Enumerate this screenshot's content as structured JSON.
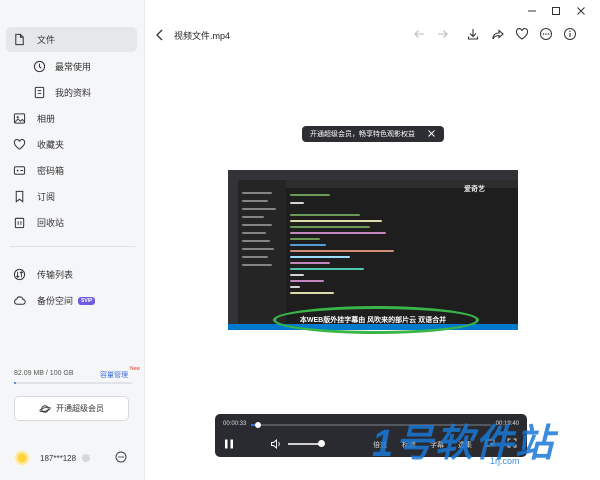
{
  "sidebar": {
    "items": [
      {
        "label": "文件",
        "icon": "file-icon",
        "active": true
      },
      {
        "label": "最常使用",
        "icon": "clock-icon"
      },
      {
        "label": "我的资料",
        "icon": "document-icon"
      },
      {
        "label": "相册",
        "icon": "image-icon"
      },
      {
        "label": "收藏夹",
        "icon": "heart-icon"
      },
      {
        "label": "密码箱",
        "icon": "vault-icon"
      },
      {
        "label": "订阅",
        "icon": "bookmark-icon"
      },
      {
        "label": "回收站",
        "icon": "trash-icon"
      },
      {
        "label": "传输列表",
        "icon": "transfer-icon"
      },
      {
        "label": "备份空间",
        "icon": "cloud-icon",
        "badge": "SVIP"
      }
    ],
    "storage_text": "82.09 MB / 100 GB",
    "storage_fraction": 0.0008,
    "expand_label": "容量管理",
    "new_badge": "New",
    "vip_button_label": "开通超级会员",
    "user_name": "187***128"
  },
  "header": {
    "title": "视频文件.mp4"
  },
  "promo": {
    "text": "开通超级会员，畅享特色观影权益"
  },
  "video": {
    "brand": "爱奇艺",
    "subtitle": "本WEB版外挂字幕由 风吹来的部片云 双语合并"
  },
  "player": {
    "current_time": "00:00:33",
    "total_time": "00:19:40",
    "progress_fraction": 0.03,
    "volume_fraction": 1.0,
    "controls": [
      "倍速",
      "标清",
      "字幕",
      "选集"
    ]
  },
  "watermark": {
    "big": "1号软件站",
    "url": "1rj.com"
  },
  "colors": {
    "accent": "#3d6fe0",
    "ellipse": "#39b54a",
    "watermark": "#1a78d6"
  }
}
